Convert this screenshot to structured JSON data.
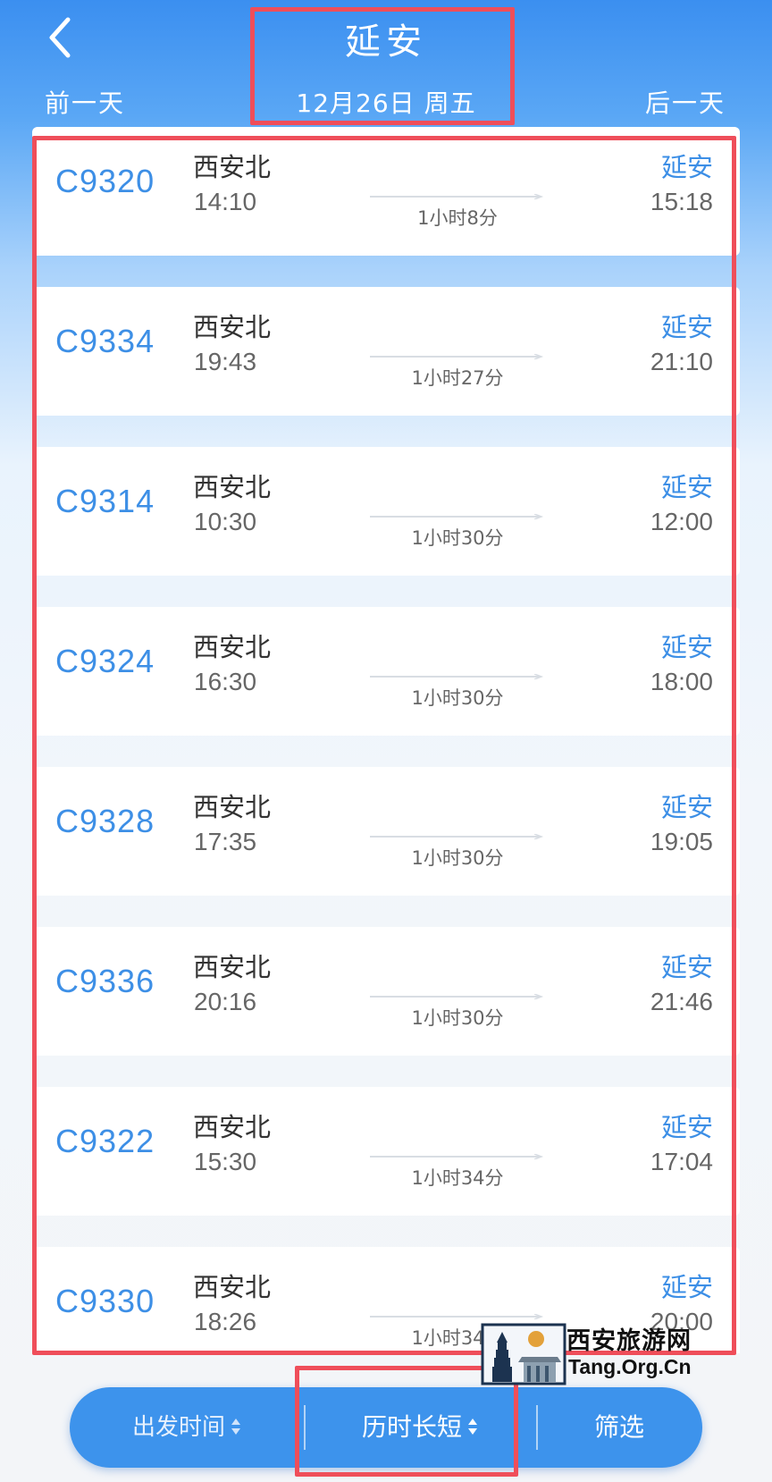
{
  "header": {
    "title": "延安",
    "date": "12月26日 周五",
    "prev_day": "前一天",
    "next_day": "后一天"
  },
  "trains": [
    {
      "code": "C9320",
      "from": "西安北",
      "depart": "14:10",
      "duration": "1小时8分",
      "to": "延安",
      "arrive": "15:18"
    },
    {
      "code": "C9334",
      "from": "西安北",
      "depart": "19:43",
      "duration": "1小时27分",
      "to": "延安",
      "arrive": "21:10"
    },
    {
      "code": "C9314",
      "from": "西安北",
      "depart": "10:30",
      "duration": "1小时30分",
      "to": "延安",
      "arrive": "12:00"
    },
    {
      "code": "C9324",
      "from": "西安北",
      "depart": "16:30",
      "duration": "1小时30分",
      "to": "延安",
      "arrive": "18:00"
    },
    {
      "code": "C9328",
      "from": "西安北",
      "depart": "17:35",
      "duration": "1小时30分",
      "to": "延安",
      "arrive": "19:05"
    },
    {
      "code": "C9336",
      "from": "西安北",
      "depart": "20:16",
      "duration": "1小时30分",
      "to": "延安",
      "arrive": "21:46"
    },
    {
      "code": "C9322",
      "from": "西安北",
      "depart": "15:30",
      "duration": "1小时34分",
      "to": "延安",
      "arrive": "17:04"
    },
    {
      "code": "C9330",
      "from": "西安北",
      "depart": "18:26",
      "duration": "1小时34分",
      "to": "延安",
      "arrive": "20:00"
    }
  ],
  "bottom_bar": {
    "sort_depart": "出发时间",
    "sort_duration": "历时长短",
    "filter": "筛选"
  },
  "watermark": {
    "name": "西安旅游网",
    "domain": "Tang.Org.Cn"
  },
  "colors": {
    "accent": "#3d8fe6",
    "highlight_box": "#ef4e5a",
    "bottom_bar": "#3d93ec"
  }
}
